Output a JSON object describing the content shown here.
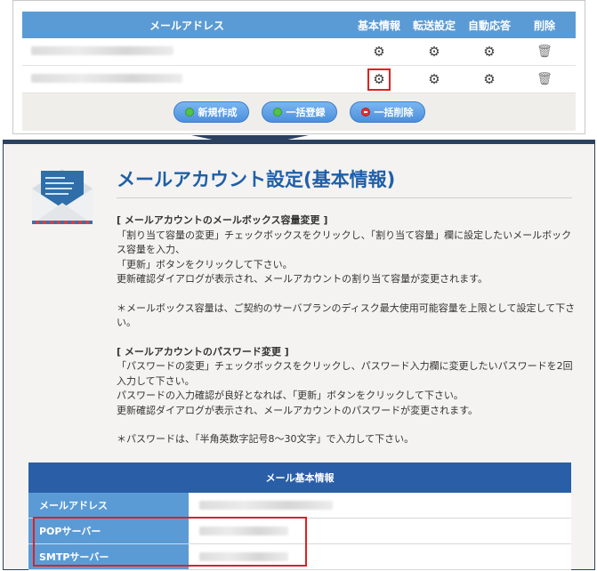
{
  "account_table": {
    "headers": {
      "mail": "メールアドレス",
      "basic": "基本情報",
      "forward": "転送設定",
      "auto_reply": "自動応答",
      "delete": "削除"
    }
  },
  "buttons": {
    "create": "新規作成",
    "bulk_register": "一括登録",
    "bulk_delete": "一括削除"
  },
  "settings": {
    "title": "メールアカウント設定(基本情報)",
    "section1_heading": "[ メールアカウントのメールボックス容量変更 ]",
    "section1_lines": [
      "「割り当て容量の変更」チェックボックスをクリックし、「割り当て容量」欄に設定したいメールボックス容量を入力、",
      "「更新」ボタンをクリックして下さい。",
      "更新確認ダイアログが表示され、メールアカウントの割り当て容量が変更されます。"
    ],
    "section1_note": "＊メールボックス容量は、ご契約のサーバプランのディスク最大使用可能容量を上限として設定して下さい。",
    "section2_heading": "[ メールアカウントのパスワード変更 ]",
    "section2_lines": [
      "「パスワードの変更」チェックボックスをクリックし、パスワード入力欄に変更したいパスワードを2回入力して下さい。",
      "パスワードの入力確認が良好となれば、「更新」ボタンをクリックして下さい。",
      "更新確認ダイアログが表示され、メールアカウントのパスワードが変更されます。"
    ],
    "section2_note": "＊パスワードは、「半角英数字記号8～30文字」で入力して下さい。"
  },
  "info_table": {
    "heading": "メール基本情報",
    "rows": {
      "mail": "メールアドレス",
      "pop": "POPサーバー",
      "smtp": "SMTPサーバー"
    }
  },
  "icons": {
    "gear": "gear-icon",
    "trash": "trash-icon",
    "envelope": "envelope-icon"
  },
  "colors": {
    "header_blue": "#5b9bd5",
    "title_blue": "#1f5fa8",
    "highlight_red": "#e02020"
  }
}
